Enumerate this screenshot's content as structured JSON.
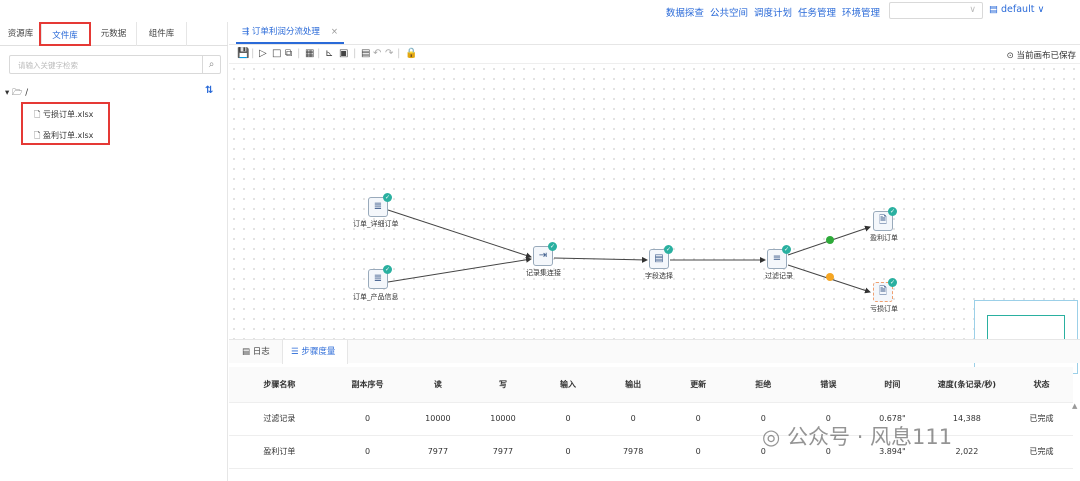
{
  "topnav": {
    "links": [
      "数据探查",
      "公共空间",
      "调度计划",
      "任务管理",
      "环境管理"
    ],
    "select_value": "",
    "user": "default"
  },
  "left": {
    "tabs": [
      "资源库",
      "文件库",
      "元数据",
      "组件库"
    ],
    "active_tab": "文件库",
    "search_placeholder": "请输入关键字检索",
    "root": "/",
    "files": [
      "亏损订单.xlsx",
      "盈利订单.xlsx"
    ]
  },
  "editor": {
    "tab_title": "订单利润分流处理",
    "saved_text": "当前画布已保存",
    "nodes": [
      "订单_详细订单",
      "订单_产品信息",
      "记录集连接",
      "字段选择",
      "过滤记录",
      "盈利订单",
      "亏损订单"
    ]
  },
  "bottom": {
    "tabs": [
      "日志",
      "步骤度量"
    ],
    "active_tab": "步骤度量",
    "columns": [
      "步骤名称",
      "副本序号",
      "读",
      "写",
      "输入",
      "输出",
      "更新",
      "拒绝",
      "错误",
      "时间",
      "速度(条记录/秒)",
      "状态"
    ],
    "rows": [
      [
        "过滤记录",
        "0",
        "10000",
        "10000",
        "0",
        "0",
        "0",
        "0",
        "0",
        "0.678\"",
        "14,388",
        "已完成"
      ],
      [
        "盈利订单",
        "0",
        "7977",
        "7977",
        "0",
        "7978",
        "0",
        "0",
        "0",
        "3.894\"",
        "2,022",
        "已完成"
      ]
    ]
  },
  "watermark": "公众号 · 风息111",
  "colors": {
    "accent": "#2a6ad8",
    "highlight": "#e53935",
    "ok": "#2ab0a0",
    "warn": "#f5a623",
    "green": "#2eaa3a"
  }
}
